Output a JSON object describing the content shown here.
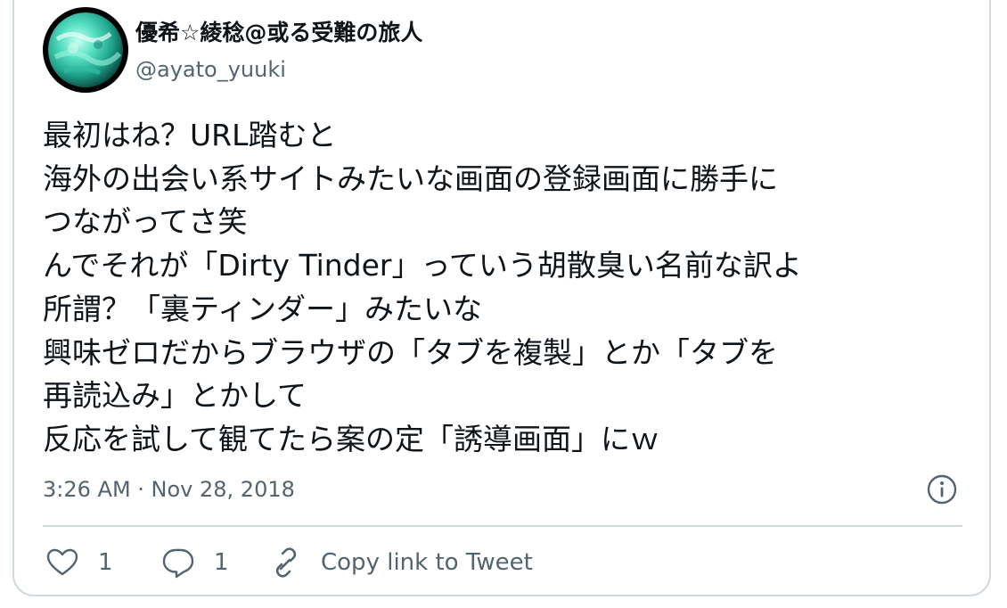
{
  "author": {
    "display_name": "優希☆綾稔@或る受難の旅人",
    "handle": "@ayato_yuuki"
  },
  "tweet": {
    "lines": [
      "最初はね？URL踏むと",
      "海外の出会い系サイトみたいな画面の登録画面に勝手に",
      "つながってさ笑",
      "んでそれが「Dirty Tinder」っていう胡散臭い名前な訳よ",
      "所謂？「裏ティンダー」みたいな",
      "興味ゼロだからブラウザの「タブを複製」とか「タブを",
      "再読込み」とかして",
      "反応を試して観てたら案の定「誘導画面」にｗ"
    ],
    "timestamp": "3:26 AM · Nov 28, 2018"
  },
  "actions": {
    "like_count": "1",
    "reply_count": "1",
    "copy_link_label": "Copy link to Tweet"
  },
  "icons": {
    "like": "heart-icon",
    "reply": "speech-bubble-icon",
    "copy": "link-icon",
    "info": "info-icon"
  },
  "colors": {
    "text_primary": "#0f1419",
    "text_secondary": "#536471",
    "border": "#cfd9de"
  }
}
